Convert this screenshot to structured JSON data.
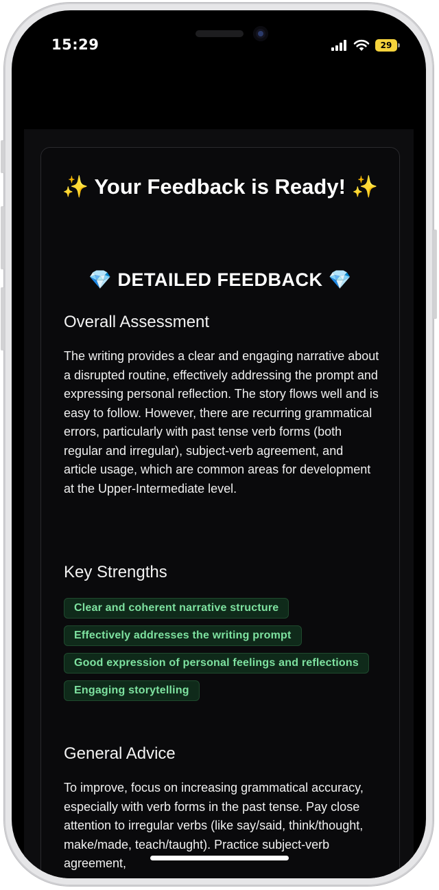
{
  "status_bar": {
    "time": "15:29",
    "battery": "29",
    "icons": [
      "signal-icon",
      "wifi-icon",
      "battery-icon"
    ]
  },
  "feedback": {
    "title": "✨ Your Feedback is Ready! ✨",
    "section_title": "💎 DETAILED FEEDBACK 💎",
    "overall": {
      "heading": "Overall Assessment",
      "text": "The writing provides a clear and engaging narrative about a disrupted routine, effectively addressing the prompt and expressing personal reflection. The story flows well and is easy to follow. However, there are recurring grammatical errors, particularly with past tense verb forms (both regular and irregular), subject-verb agreement, and article usage, which are common areas for development at the Upper-Intermediate level."
    },
    "strengths": {
      "heading": "Key Strengths",
      "items": [
        "Clear and coherent narrative structure",
        "Effectively addresses the writing prompt",
        "Good expression of personal feelings and reflections",
        "Engaging storytelling"
      ]
    },
    "advice": {
      "heading": "General Advice",
      "text": "To improve, focus on increasing grammatical accuracy, especially with verb forms in the past tense. Pay close attention to irregular verbs (like say/said, think/thought, make/made, teach/taught). Practice subject-verb agreement,"
    }
  },
  "colors": {
    "background": "#000000",
    "card": "#0a0a0c",
    "tag_text": "#7ee2a0",
    "tag_bg": "#0f2a1a",
    "battery": "#f5d33c"
  }
}
